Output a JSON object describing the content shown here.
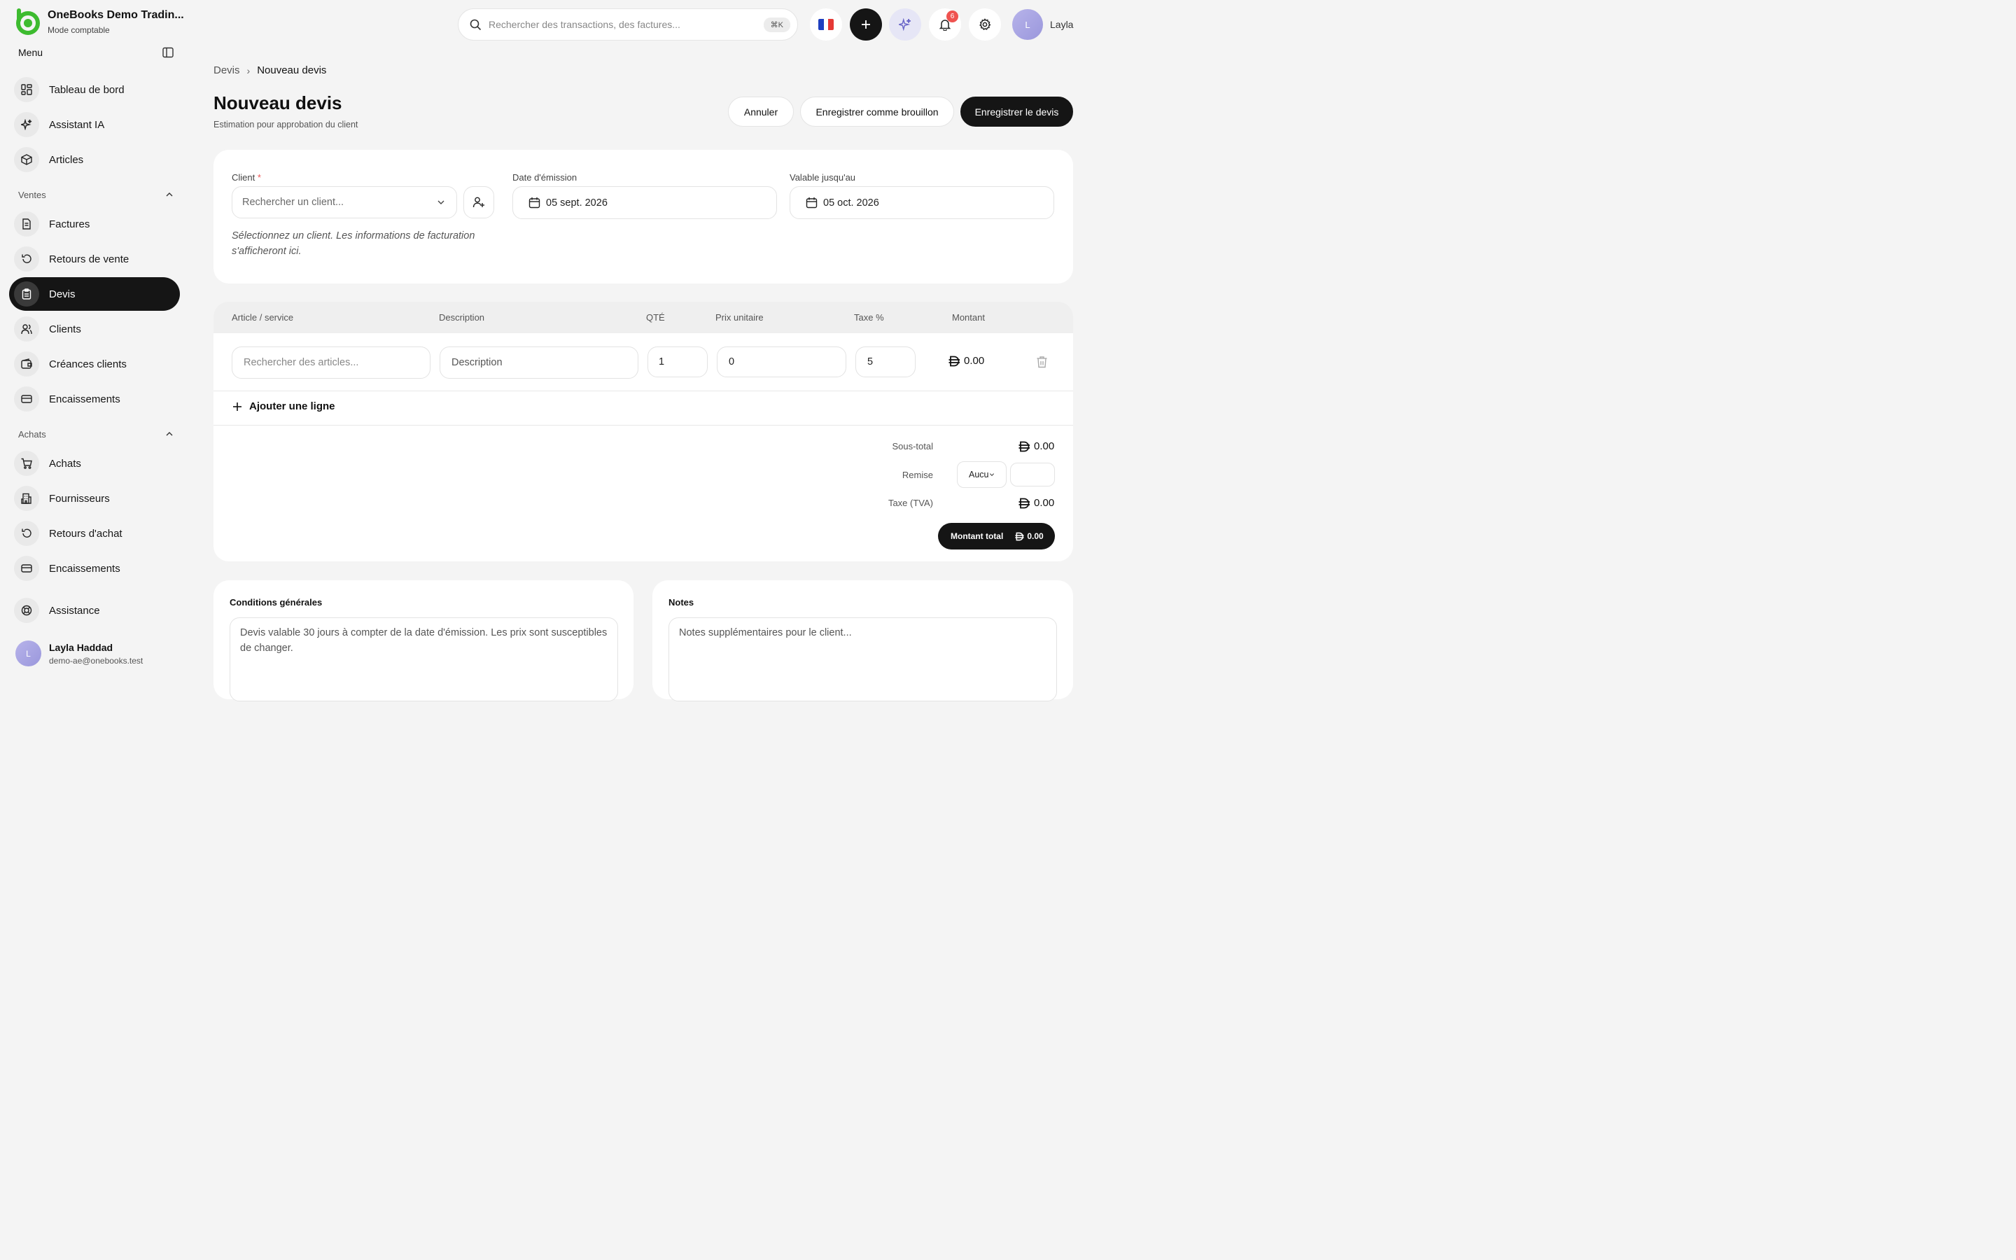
{
  "brand": {
    "name": "OneBooks Demo Tradin...",
    "subtitle": "Mode comptable"
  },
  "sidebar": {
    "menu_title": "Menu",
    "top_items": [
      {
        "label": "Tableau de bord",
        "icon": "dashboard-icon"
      },
      {
        "label": "Assistant IA",
        "icon": "sparkle-icon"
      },
      {
        "label": "Articles",
        "icon": "box-icon"
      }
    ],
    "sales_section": "Ventes",
    "sales_items": [
      {
        "label": "Factures",
        "icon": "invoice-icon"
      },
      {
        "label": "Retours de vente",
        "icon": "return-icon"
      },
      {
        "label": "Devis",
        "icon": "clipboard-icon",
        "active": true
      },
      {
        "label": "Clients",
        "icon": "users-icon"
      },
      {
        "label": "Créances clients",
        "icon": "wallet-icon"
      },
      {
        "label": "Encaissements",
        "icon": "card-icon"
      }
    ],
    "purchases_section": "Achats",
    "purchase_items": [
      {
        "label": "Achats",
        "icon": "cart-icon"
      },
      {
        "label": "Fournisseurs",
        "icon": "building-icon"
      },
      {
        "label": "Retours d'achat",
        "icon": "return-icon"
      },
      {
        "label": "Encaissements",
        "icon": "card-icon"
      }
    ],
    "support_item": {
      "label": "Assistance",
      "icon": "lifebuoy-icon"
    },
    "profile": {
      "initial": "L",
      "name": "Layla Haddad",
      "email": "demo-ae@onebooks.test"
    }
  },
  "topbar": {
    "search_placeholder": "Rechercher des transactions, des factures...",
    "shortcut": "⌘K",
    "notification_count": "6",
    "user_initial": "L",
    "user_name": "Layla",
    "language_flag": "fr-flag-icon"
  },
  "header": {
    "breadcrumb_parent": "Devis",
    "breadcrumb_current": "Nouveau devis",
    "title": "Nouveau devis",
    "subtitle": "Estimation pour approbation du client",
    "cancel_label": "Annuler",
    "draft_label": "Enregistrer comme brouillon",
    "save_label": "Enregistrer le devis"
  },
  "client_card": {
    "client_label": "Client",
    "client_required": "*",
    "client_placeholder": "Rechercher un client...",
    "hint": "Sélectionnez un client. Les informations de facturation s'afficheront ici.",
    "issue_date_label": "Date d'émission",
    "issue_date": "05 sept. 2026",
    "valid_until_label": "Valable jusqu'au",
    "valid_until": "05 oct. 2026"
  },
  "items_table": {
    "columns": [
      "Article / service",
      "Description",
      "QTÉ",
      "Prix unitaire",
      "Taxe %",
      "Montant"
    ],
    "row": {
      "article_placeholder": "Rechercher des articles...",
      "description_placeholder": "Description",
      "qty": "1",
      "unit_price": "0",
      "tax": "5",
      "amount": "0.00"
    },
    "add_line_label": "Ajouter une ligne"
  },
  "totals": {
    "subtotal_label": "Sous-total",
    "subtotal": "0.00",
    "discount_label": "Remise",
    "discount_type": "Aucu",
    "tax_label": "Taxe (TVA)",
    "tax": "0.00",
    "total_label": "Montant total",
    "total": "0.00",
    "currency_symbol": "AED"
  },
  "terms": {
    "title": "Conditions générales",
    "text": "Devis valable 30 jours à compter de la date d'émission. Les prix sont susceptibles de changer."
  },
  "notes": {
    "title": "Notes",
    "placeholder": "Notes supplémentaires pour le client..."
  },
  "colors": {
    "accent_green": "#3dbb2f",
    "dark": "#151515",
    "badge_red": "#ef5350"
  }
}
